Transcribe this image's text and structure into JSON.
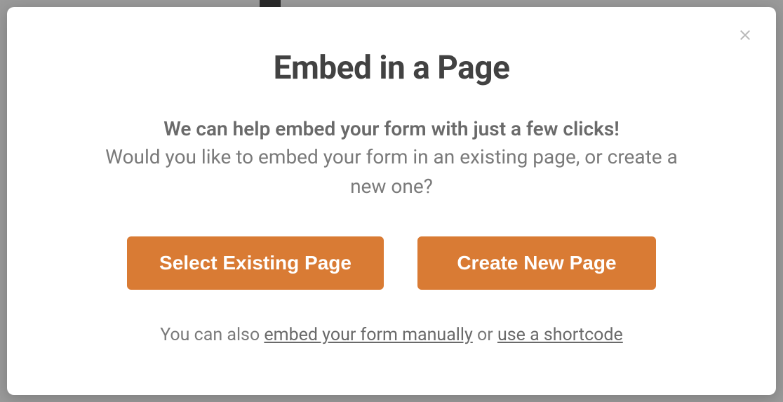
{
  "modal": {
    "title": "Embed in a Page",
    "subtitle_bold": "We can help embed your form with just a few clicks!",
    "subtitle_regular": "Would you like to embed your form in an existing page, or create a new one?",
    "buttons": {
      "select_existing": "Select Existing Page",
      "create_new": "Create New Page"
    },
    "footer": {
      "prefix": "You can also ",
      "link_manual": "embed your form manually",
      "middle": " or ",
      "link_shortcode": "use a shortcode"
    }
  }
}
